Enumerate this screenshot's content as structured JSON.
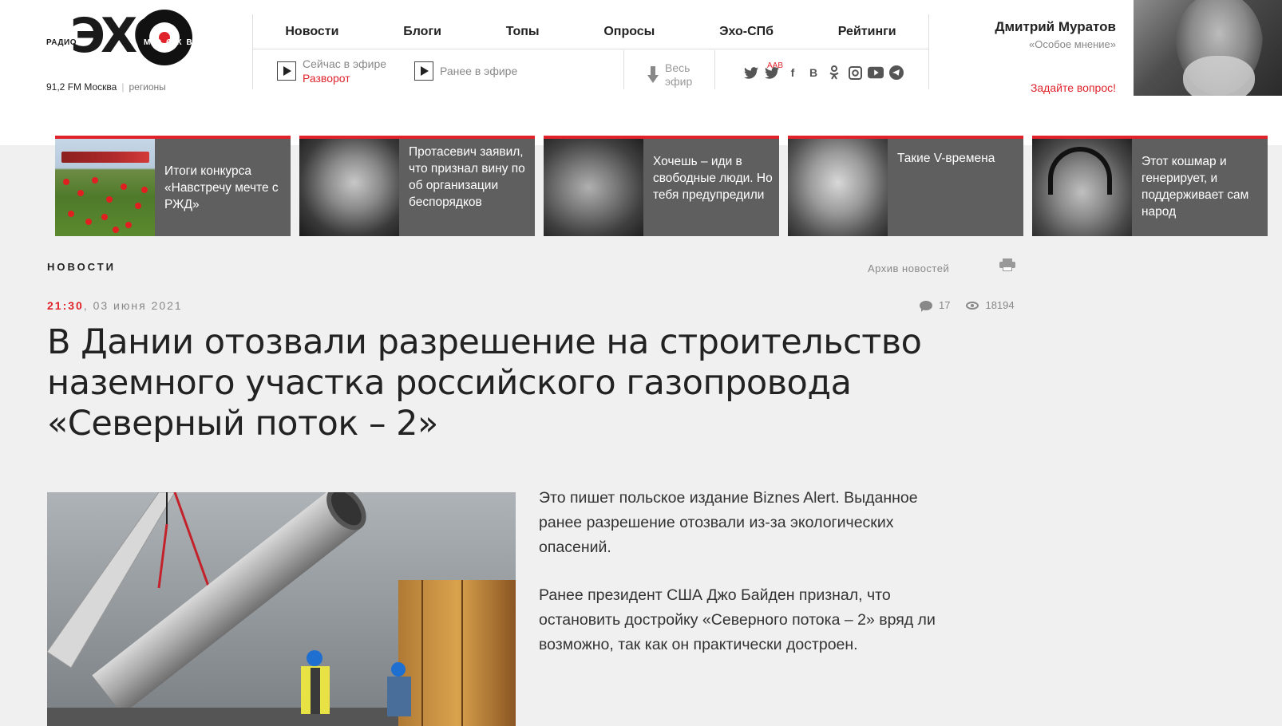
{
  "logo": {
    "radio": "РАДИО",
    "eho": "ЭХО",
    "moskvy": "МОСКВЫ",
    "frequency": "91,2 FM Москва",
    "regions": "регионы"
  },
  "nav": {
    "items": [
      "Новости",
      "Блоги",
      "Топы",
      "Опросы",
      "Эхо-СПб",
      "Рейтинги"
    ]
  },
  "onair": {
    "now_label": "Сейчас в эфире",
    "now_show": "Разворот",
    "earlier_label": "Ранее в эфире",
    "all_label_1": "Весь",
    "all_label_2": "эфир"
  },
  "socials": {
    "aab": "AAB",
    "icons": [
      "twitter-icon",
      "twitter-icon",
      "facebook-icon",
      "vk-icon",
      "odnoklassniki-icon",
      "instagram-icon",
      "youtube-icon",
      "telegram-icon"
    ]
  },
  "guest": {
    "name": "Дмитрий Муратов",
    "show": "«Особое мнение»",
    "ask": "Задайте вопрос!"
  },
  "cards": [
    {
      "text": "Итоги конкурса «Навстречу мечте с РЖД»"
    },
    {
      "text": "Протасевич заявил, что признал вину по об организации беспорядков"
    },
    {
      "text": "Хочешь – иди в свободные люди. Но тебя предупредили"
    },
    {
      "text": "Такие V-времена"
    },
    {
      "text": "Этот кошмар и генерирует, и поддерживает сам народ"
    }
  ],
  "article": {
    "section": "НОВОСТИ",
    "archive": "Архив новостей",
    "time": "21:30",
    "date": ", 03 июня 2021",
    "comments": "17",
    "views": "18194",
    "headline": "В Дании отозвали разрешение на строительство наземного участка российского газопровода «Северный поток – 2»",
    "paragraphs": [
      "Это пишет польское издание Biznes Alert. Выданное ранее разрешение отозвали из-за экологических опасений.",
      "Ранее президент США Джо Байден признал, что остановить достройку «Северного потока – 2» вряд ли возможно, так как он практически достроен."
    ]
  },
  "colors": {
    "accent": "#e0232b",
    "card_bg": "#5f5f5f",
    "page_bg": "#f0f0f0"
  }
}
